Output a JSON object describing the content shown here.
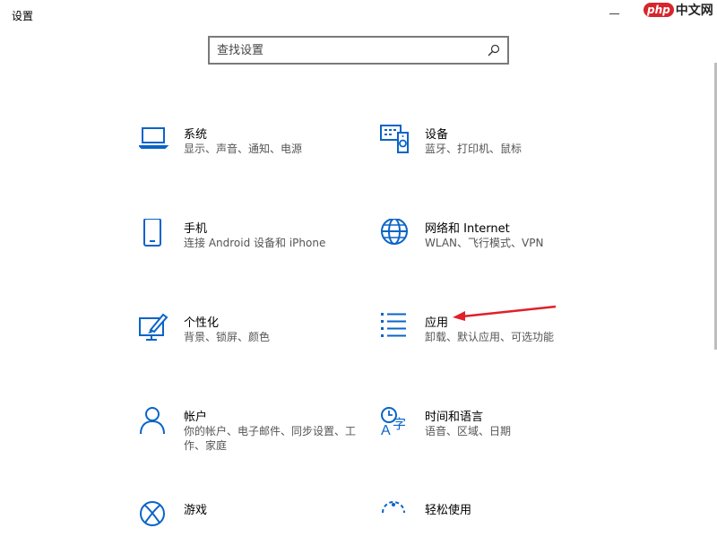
{
  "window": {
    "title": "设置"
  },
  "watermark": {
    "logo": "php",
    "text": "中文网"
  },
  "search": {
    "placeholder": "查找设置",
    "value": ""
  },
  "accent": "#0a64c8",
  "arrow_color": "#e0212a",
  "tiles": [
    {
      "icon": "laptop-icon",
      "name": "系统",
      "desc": "显示、声音、通知、电源"
    },
    {
      "icon": "devices-icon",
      "name": "设备",
      "desc": "蓝牙、打印机、鼠标"
    },
    {
      "icon": "phone-icon",
      "name": "手机",
      "desc": "连接 Android 设备和 iPhone"
    },
    {
      "icon": "globe-icon",
      "name": "网络和 Internet",
      "desc": "WLAN、飞行模式、VPN"
    },
    {
      "icon": "personalization-icon",
      "name": "个性化",
      "desc": "背景、锁屏、颜色"
    },
    {
      "icon": "apps-list-icon",
      "name": "应用",
      "desc": "卸载、默认应用、可选功能"
    },
    {
      "icon": "person-icon",
      "name": "帐户",
      "desc": "你的帐户、电子邮件、同步设置、工作、家庭"
    },
    {
      "icon": "time-language-icon",
      "name": "时间和语言",
      "desc": "语音、区域、日期"
    },
    {
      "icon": "xbox-icon",
      "name": "游戏",
      "desc": ""
    },
    {
      "icon": "ease-of-access-icon",
      "name": "轻松使用",
      "desc": ""
    }
  ]
}
